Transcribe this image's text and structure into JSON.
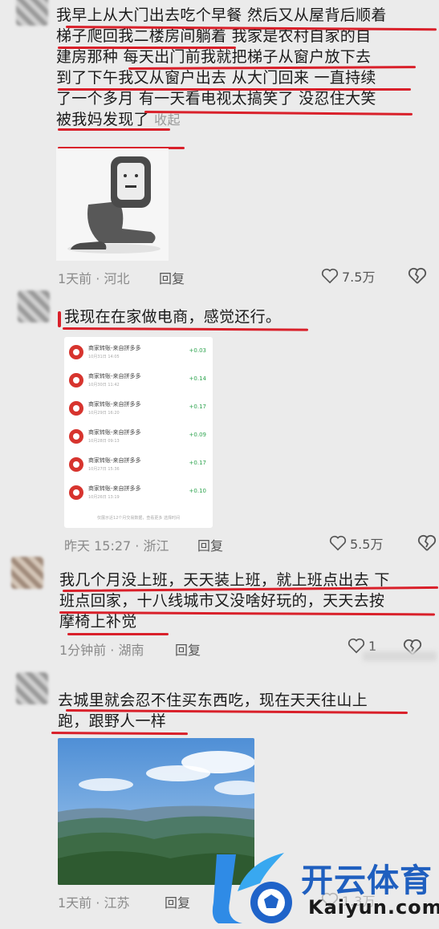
{
  "comments": [
    {
      "lines": [
        "我早上从大门出去吃个早餐 然后又从屋背后顺着",
        "梯子爬回我二楼房间躺着  我家是农村自家的自",
        "建房那种  每天出门前我就把梯子从窗户放下去",
        "到了下午我又从窗户出去 从大门回来 一直持续",
        "了一个多月 有一天看电视太搞笑了 没忍住大笑",
        "被我妈发现了"
      ],
      "collapse_label": "收起",
      "time": "1天前",
      "location": "河北",
      "reply_label": "回复",
      "likes": "7.5万"
    },
    {
      "lines": [
        "我现在在家做电商，感觉还行。"
      ],
      "time": "昨天 15:27",
      "location": "浙江",
      "reply_label": "回复",
      "likes": "5.5万",
      "orders": [
        {
          "name": "商家转账-来自拼多多",
          "date": "10月31日 14:05",
          "amount": "+0.03"
        },
        {
          "name": "商家转账-来自拼多多",
          "date": "10月30日 11:42",
          "amount": "+0.14"
        },
        {
          "name": "商家转账-来自拼多多",
          "date": "10月29日 16:20",
          "amount": "+0.17"
        },
        {
          "name": "商家转账-来自拼多多",
          "date": "10月28日 09:13",
          "amount": "+0.09"
        },
        {
          "name": "商家转账-来自拼多多",
          "date": "10月27日 15:36",
          "amount": "+0.17"
        },
        {
          "name": "商家转账-来自拼多多",
          "date": "10月26日 13:19",
          "amount": "+0.10"
        }
      ],
      "orders_footer": "仅展示近12个月交易数据，查看更多 选择时间"
    },
    {
      "lines": [
        "我几个月没上班，天天装上班，就上班点出去 下",
        "班点回家，十八线城市又没啥好玩的，天天去按",
        "摩椅上补觉"
      ],
      "time": "1分钟前",
      "location": "湖南",
      "reply_label": "回复",
      "likes": "1"
    },
    {
      "lines": [
        "去城里就会忍不住买东西吃，现在天天往山上",
        "跑，跟野人一样"
      ],
      "time": "1天前",
      "location": "江苏",
      "reply_label": "回复",
      "likes": "1.3万"
    }
  ],
  "meta_separator": "·",
  "watermark": {
    "brand": "开云体育",
    "domain": "Kaiyun.com"
  },
  "colors": {
    "underline": "#d9202a",
    "background": "#ebebeb",
    "brand_blue": "#1f5fbf"
  },
  "icons": [
    "heart-icon",
    "broken-heart-icon",
    "shop-icon",
    "sticker-image",
    "landscape-image"
  ]
}
